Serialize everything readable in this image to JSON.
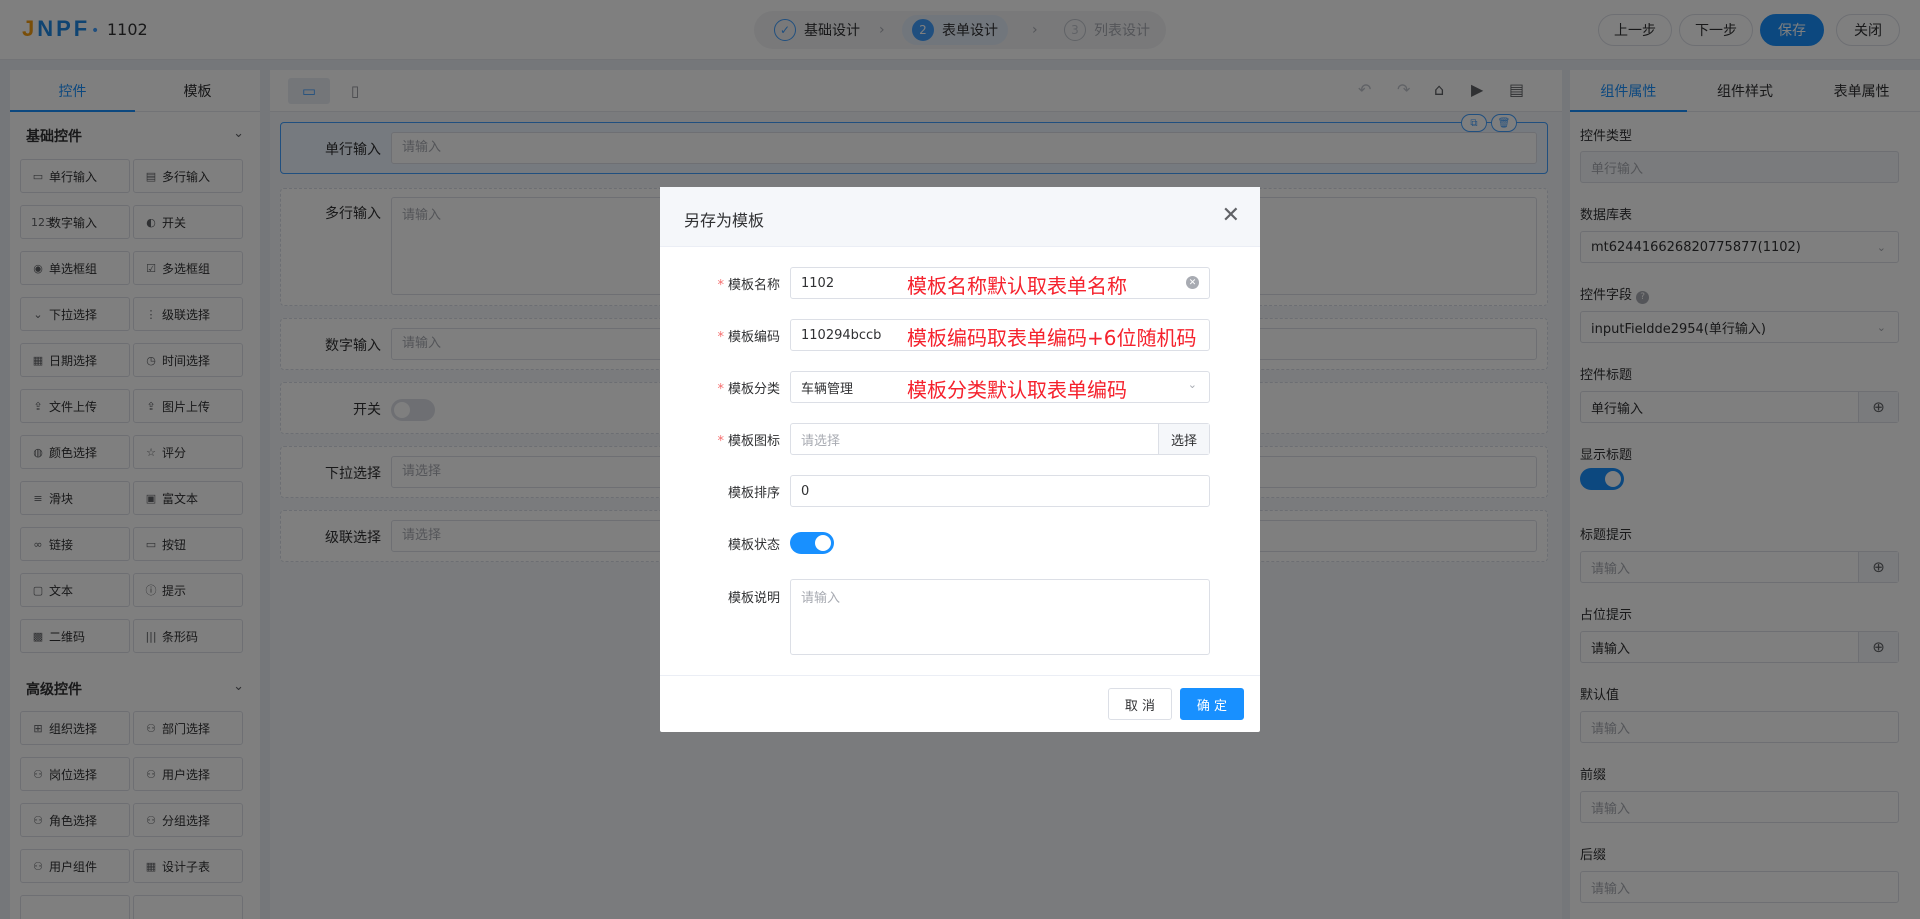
{
  "header": {
    "logo": "JNPF",
    "form_name": "1102",
    "steps": [
      {
        "num": "✓",
        "label": "基础设计"
      },
      {
        "num": "2",
        "label": "表单设计"
      },
      {
        "num": "3",
        "label": "列表设计"
      }
    ],
    "prev_label": "上一步",
    "next_label": "下一步",
    "save_label": "保存",
    "close_label": "关闭"
  },
  "left_panel": {
    "tabs": [
      "控件",
      "模板"
    ],
    "basic_title": "基础控件",
    "basic": [
      {
        "label": "单行输入",
        "icon": "▭"
      },
      {
        "label": "多行输入",
        "icon": "▤"
      },
      {
        "label": "数字输入",
        "icon": "123"
      },
      {
        "label": "开关",
        "icon": "◐"
      },
      {
        "label": "单选框组",
        "icon": "◉"
      },
      {
        "label": "多选框组",
        "icon": "☑"
      },
      {
        "label": "下拉选择",
        "icon": "⌄"
      },
      {
        "label": "级联选择",
        "icon": "⋮"
      },
      {
        "label": "日期选择",
        "icon": "▦"
      },
      {
        "label": "时间选择",
        "icon": "◷"
      },
      {
        "label": "文件上传",
        "icon": "⇪"
      },
      {
        "label": "图片上传",
        "icon": "⇪"
      },
      {
        "label": "颜色选择",
        "icon": "◍"
      },
      {
        "label": "评分",
        "icon": "☆"
      },
      {
        "label": "滑块",
        "icon": "≡"
      },
      {
        "label": "富文本",
        "icon": "▣"
      },
      {
        "label": "链接",
        "icon": "∞"
      },
      {
        "label": "按钮",
        "icon": "▭"
      },
      {
        "label": "文本",
        "icon": "▢"
      },
      {
        "label": "提示",
        "icon": "ⓘ"
      },
      {
        "label": "二维码",
        "icon": "▩"
      },
      {
        "label": "条形码",
        "icon": "|||"
      }
    ],
    "advanced_title": "高级控件",
    "advanced": [
      {
        "label": "组织选择",
        "icon": "⊞"
      },
      {
        "label": "部门选择",
        "icon": "⚇"
      },
      {
        "label": "岗位选择",
        "icon": "⚇"
      },
      {
        "label": "用户选择",
        "icon": "⚇"
      },
      {
        "label": "角色选择",
        "icon": "⚇"
      },
      {
        "label": "分组选择",
        "icon": "⚇"
      },
      {
        "label": "用户组件",
        "icon": "⚇"
      },
      {
        "label": "设计子表",
        "icon": "▦"
      },
      {
        "label": "",
        "icon": ""
      },
      {
        "label": "",
        "icon": ""
      }
    ]
  },
  "canvas": {
    "fields": [
      {
        "label": "单行输入",
        "placeholder": "请输入"
      },
      {
        "label": "多行输入",
        "placeholder": "请输入"
      },
      {
        "label": "数字输入",
        "placeholder": "请输入"
      },
      {
        "label": "开关",
        "placeholder": ""
      },
      {
        "label": "下拉选择",
        "placeholder": "请选择"
      },
      {
        "label": "级联选择",
        "placeholder": "请选择"
      }
    ]
  },
  "right_panel": {
    "tabs": [
      "组件属性",
      "组件样式",
      "表单属性"
    ],
    "control_type_label": "控件类型",
    "control_type_value": "单行输入",
    "db_table_label": "数据库表",
    "db_table_value": "mt624416626820775877(1102)",
    "field_label": "控件字段",
    "field_value": "inputFieldde2954(单行输入)",
    "title_label": "控件标题",
    "title_value": "单行输入",
    "show_title_label": "显示标题",
    "title_tip_label": "标题提示",
    "title_tip_placeholder": "请输入",
    "placeholder_label": "占位提示",
    "placeholder_value": "请输入",
    "default_label": "默认值",
    "default_placeholder": "请输入",
    "prefix_label": "前缀",
    "prefix_placeholder": "请输入",
    "suffix_label": "后缀",
    "suffix_placeholder": "请输入"
  },
  "dialog": {
    "title": "另存为模板",
    "name_label": "模板名称",
    "name_value": "1102",
    "name_note": "模板名称默认取表单名称",
    "code_label": "模板编码",
    "code_value": "110294bccb",
    "code_note": "模板编码取表单编码+6位随机码",
    "category_label": "模板分类",
    "category_value": "车辆管理",
    "category_note": "模板分类默认取表单编码",
    "icon_label": "模板图标",
    "icon_placeholder": "请选择",
    "icon_pick": "选择",
    "sort_label": "模板排序",
    "sort_value": "0",
    "status_label": "模板状态",
    "desc_label": "模板说明",
    "desc_placeholder": "请输入",
    "cancel_label": "取 消",
    "ok_label": "确 定"
  },
  "colors": {
    "primary": "#1890ff",
    "annotation": "#f5222d"
  }
}
